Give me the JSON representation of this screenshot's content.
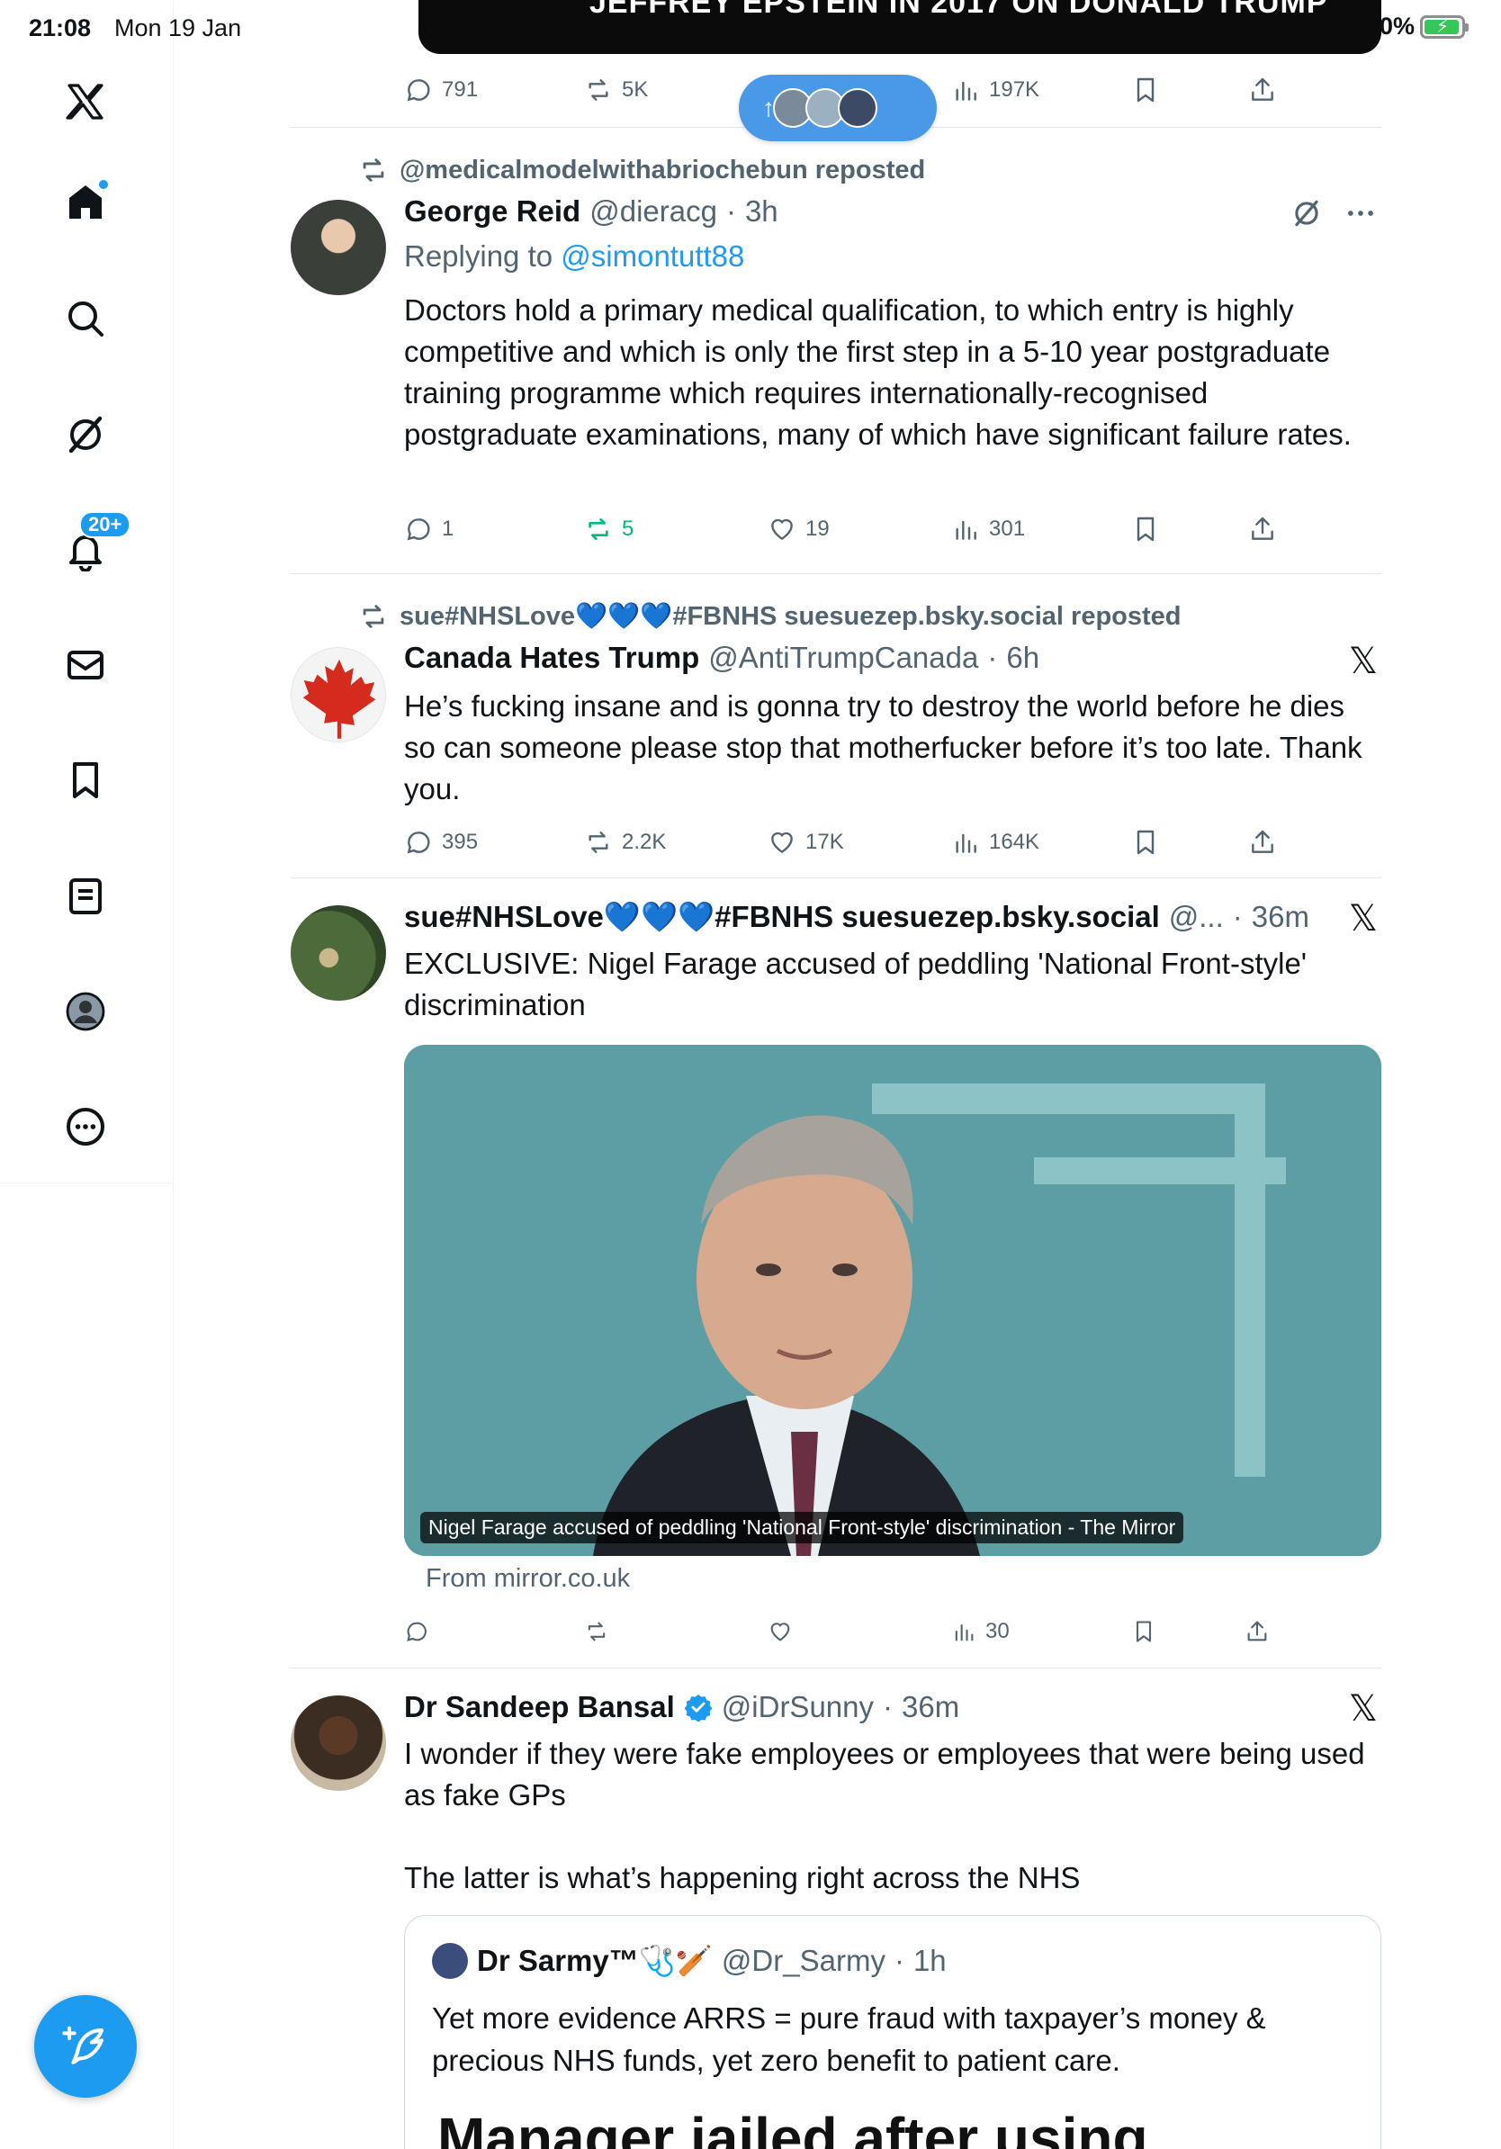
{
  "status_bar": {
    "time": "21:08",
    "date": "Mon 19 Jan",
    "battery": "0%"
  },
  "colors": {
    "accent": "#1d9bf0",
    "repost_green": "#00ba7c",
    "secondary_text": "#536471"
  },
  "sidebar": {
    "items": [
      {
        "icon": "x-logo-icon"
      },
      {
        "icon": "home-icon"
      },
      {
        "icon": "search-icon"
      },
      {
        "icon": "grok-icon"
      },
      {
        "icon": "notifications-icon",
        "badge": "20+"
      },
      {
        "icon": "messages-icon"
      },
      {
        "icon": "bookmarks-icon"
      },
      {
        "icon": "lists-icon"
      },
      {
        "icon": "profile-icon"
      },
      {
        "icon": "more-icon"
      }
    ],
    "compose_icon": "compose-icon"
  },
  "top_post": {
    "media_text": "JEFFREY EPSTEIN IN 2017 ON DONALD TRUMP",
    "replies": "791",
    "reposts": "5K",
    "views": "197K"
  },
  "new_posts_pill": {
    "arrow": "↑"
  },
  "posts": [
    {
      "repost_by": "@medicalmodelwithabriochebun reposted",
      "name": "George Reid",
      "handle": "@dieracg",
      "time": "3h",
      "replying_label": "Replying to",
      "replying_to": "@simontutt88",
      "text": "Doctors hold a primary medical qualification, to which entry is highly competitive and which is only the first step in a 5-10 year postgraduate training programme which requires internationally-recognised postgraduate examinations, many of which have significant failure rates.",
      "replies": "1",
      "reposts": "5",
      "likes": "19",
      "views": "301"
    },
    {
      "repost_by": "sue#NHSLove💙💙💙#FBNHS suesuezep.bsky.social reposted",
      "name": "Canada Hates Trump",
      "handle": "@AntiTrumpCanada",
      "time": "6h",
      "text": "He’s fucking insane and is gonna try to destroy the world before he dies so can someone please stop that motherfucker before it’s too late. Thank you.",
      "replies": "395",
      "reposts": "2.2K",
      "likes": "17K",
      "views": "164K"
    },
    {
      "name": "sue#NHSLove💙💙💙#FBNHS suesuezep.bsky.social",
      "handle": "@...",
      "time": "36m",
      "text": "EXCLUSIVE: Nigel Farage accused of peddling 'National Front-style' discrimination",
      "card_caption": "Nigel Farage accused of peddling 'National Front-style' discrimination - The Mirror",
      "card_source": "From mirror.co.uk",
      "views": "30"
    },
    {
      "name": "Dr Sandeep Bansal",
      "handle": "@iDrSunny",
      "time": "36m",
      "text": "I wonder if they were fake employees or employees that were being used as fake GPs\n\nThe latter is what’s happening right across the NHS",
      "quote": {
        "name": "Dr Sarmy™🩺🏏",
        "handle": "@Dr_Sarmy",
        "time": "1h",
        "text": "Yet more evidence ARRS = pure fraud with taxpayer’s money & precious NHS funds, yet zero benefit to patient care.",
        "headline": "Manager jailed after using"
      }
    }
  ],
  "dot": "·"
}
